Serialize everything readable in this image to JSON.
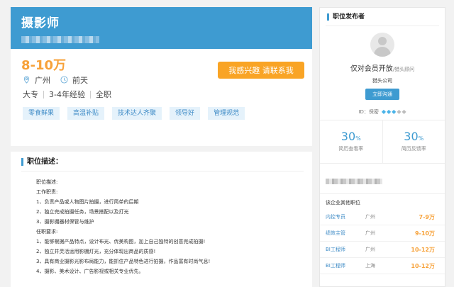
{
  "job": {
    "title": "摄影师",
    "salary": "8-10万",
    "apply_label": "我感兴趣 请联系我",
    "city": "广州",
    "posted": "前天",
    "education": "大专",
    "experience": "3-4年经验",
    "type": "全职",
    "tags": [
      "零食鲜果",
      "高温补贴",
      "技术达人齐聚",
      "领导好",
      "管理规范"
    ]
  },
  "description": {
    "title": "职位描述：",
    "lines": [
      "职位描述:",
      "工作职责:",
      "1、负责产品或人物图片拍摄，进行简单的后期",
      "2、独立完成拍摄任务，场景搭配以及打光",
      "3、摄影棚器材保管与维护",
      "任职要求:",
      "1、能够根据产品特点，设计布光、优美构图，加上自己独特的创意完成拍摄!",
      "2、独立并灵活运用影棚灯光，充分体现出商品的质感!",
      "3、具有商业摄影光影布局能力，能抓住产品特色进行拍摄，作品富有时尚气息!",
      "4、摄影、美术设计、广告影视或相关专业优先。"
    ]
  },
  "publisher": {
    "section_title": "职位发布者",
    "member_text": "仅对会员开放",
    "member_note": "/猎头顾问",
    "company": "猎头公司",
    "chat_label": "立即沟通",
    "id_label": "ID：保密",
    "gems_colors": [
      "#4ab3e8",
      "#4ab3e8",
      "#4ab3e8",
      "#bdbdbd",
      "#bdbdbd"
    ],
    "stats": [
      {
        "value": "30",
        "unit": "%",
        "label": "简历查看率"
      },
      {
        "value": "30",
        "unit": "%",
        "label": "简历反馈率"
      }
    ]
  },
  "other_jobs": {
    "title": "该企业其他职位",
    "items": [
      {
        "name": "内控专员",
        "city": "广州",
        "salary": "7-9万"
      },
      {
        "name": "绩效主管",
        "city": "广州",
        "salary": "9-10万"
      },
      {
        "name": "BI工程师",
        "city": "广州",
        "salary": "10-12万"
      },
      {
        "name": "BI工程师",
        "city": "上海",
        "salary": "10-12万"
      }
    ]
  },
  "colors": {
    "accent": "#3e9bd1",
    "salary": "#f7a23a",
    "apply": "#f9a425"
  }
}
